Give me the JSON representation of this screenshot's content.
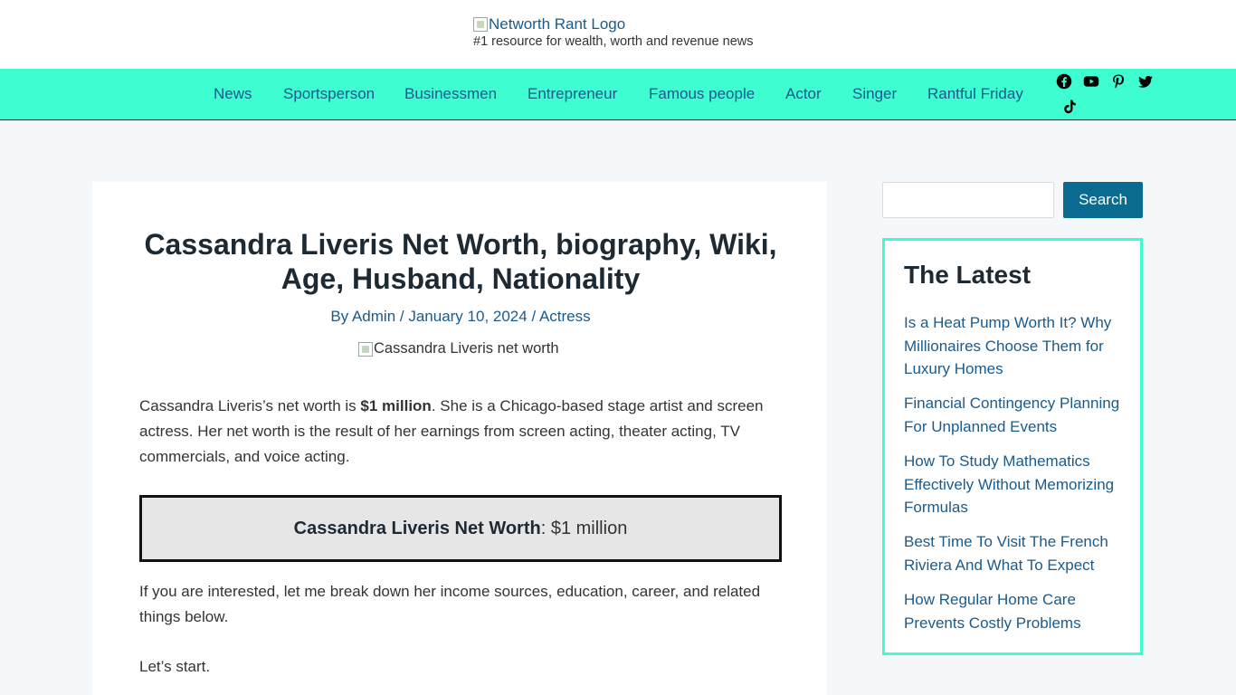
{
  "header": {
    "logo_alt": "Networth Rant Logo",
    "tagline": "#1 resource for wealth, worth and revenue news"
  },
  "nav": {
    "items": [
      "News",
      "Sportsperson",
      "Businessmen",
      "Entrepreneur",
      "Famous people",
      "Actor",
      "Singer",
      "Rantful Friday"
    ],
    "social": [
      "facebook-icon",
      "youtube-icon",
      "pinterest-icon",
      "twitter-icon",
      "tiktok-icon"
    ]
  },
  "article": {
    "title": "Cassandra Liveris Net Worth, biography, Wiki, Age, Husband, Nationality",
    "meta": {
      "author": "By Admin",
      "sep1": " / ",
      "date": "January 10, 2024",
      "sep2": " / ",
      "category": "Actress"
    },
    "image_alt": "Cassandra Liveris net worth",
    "p1_before": "Cassandra Liveris’s net worth is ",
    "p1_bold": "$1 million",
    "p1_after": ". She is a Chicago-based stage artist and screen actress. Her net worth is the result of her earnings from screen acting, theater acting, TV commercials, and voice acting.",
    "box_label": "Cassandra Liveris Net Worth",
    "box_value": ": $1 million",
    "p2": "If you are interested, let me break down her income sources, education, career, and related things below.",
    "p3": "Let’s start."
  },
  "sidebar": {
    "search_placeholder": "",
    "search_button": "Search",
    "latest_title": "The Latest",
    "latest_links": [
      "Is a Heat Pump Worth It? Why Millionaires Choose Them for Luxury Homes",
      "Financial Contingency Planning For Unplanned Events",
      "How To Study Mathematics Effectively Without Memorizing Formulas",
      "Best Time To Visit The French Riviera And What To Expect",
      "How Regular Home Care Prevents Costly Problems"
    ]
  },
  "colors": {
    "nav_bg": "#3dfdd1",
    "link": "#1a5b8c",
    "button_bg": "#0b6a8f"
  }
}
